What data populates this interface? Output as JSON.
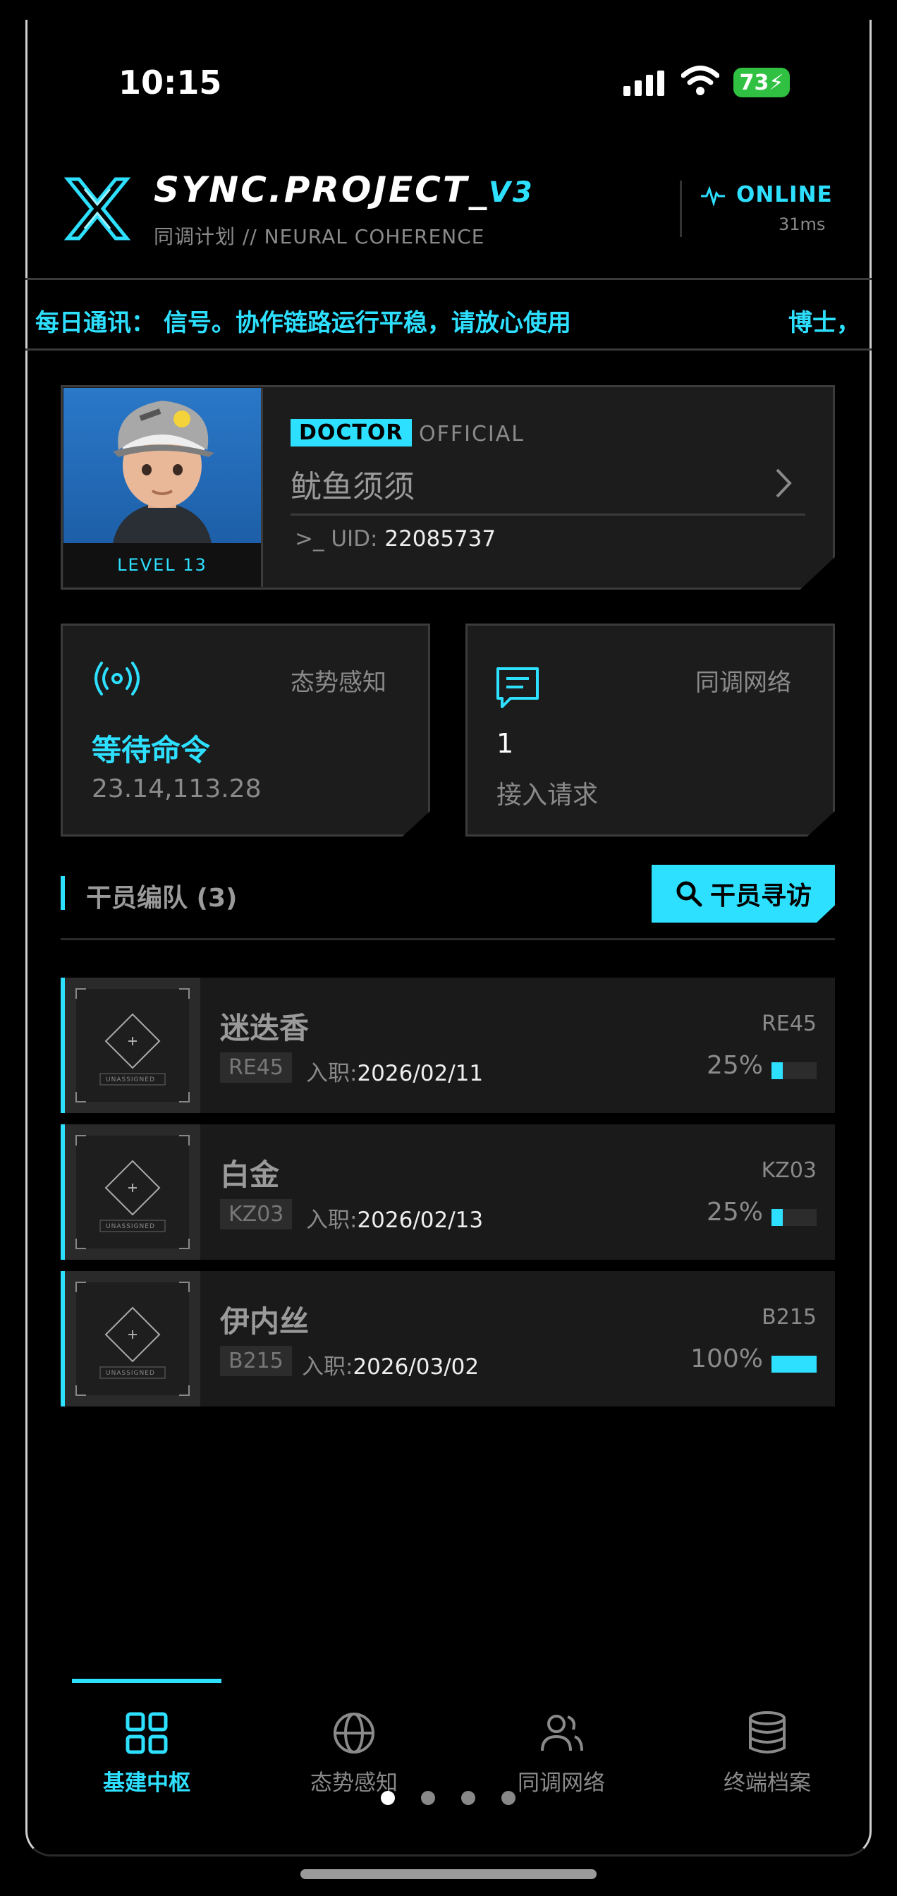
{
  "status_bar": {
    "time": "10:15",
    "battery": "73"
  },
  "header": {
    "brand": "SYNC.PROJECT_",
    "version": "V3",
    "subtitle": "同调计划 // NEURAL COHERENCE",
    "status": "ONLINE",
    "latency": "31ms"
  },
  "ticker": {
    "text": "每日通讯：  信号。协作链路运行平稳，请放心使用",
    "tail": "博士，"
  },
  "profile": {
    "badge": "DOCTOR",
    "badge_tag": "OFFICIAL",
    "name": "鱿鱼须须",
    "uid_label": ">_ UID:",
    "uid": "22085737",
    "level": "LEVEL 13"
  },
  "cards": [
    {
      "title": "态势感知",
      "icon": "radar-icon",
      "value": "等待命令",
      "detail": "23.14,113.28"
    },
    {
      "title": "同调网络",
      "icon": "chat-icon",
      "value": "1",
      "detail": "接入请求"
    }
  ],
  "section": {
    "title": "干员编队 (3)",
    "search_label": "干员寻访"
  },
  "operators": [
    {
      "name": "迷迭香",
      "code": "RE45",
      "join_label": "入职:",
      "date": "2026/02/11",
      "progress": "25%",
      "progress_value": 0.25,
      "thumb": "UNASSIGNED"
    },
    {
      "name": "白金",
      "code": "KZ03",
      "join_label": "入职:",
      "date": "2026/02/13",
      "progress": "25%",
      "progress_value": 0.25,
      "thumb": "UNASSIGNED"
    },
    {
      "name": "伊内丝",
      "code": "B215",
      "join_label": "入职:",
      "date": "2026/03/02",
      "progress": "100%",
      "progress_value": 1.0,
      "thumb": "UNASSIGNED"
    }
  ],
  "nav": [
    {
      "label": "基建中枢",
      "icon": "dashboard-icon",
      "active": true
    },
    {
      "label": "态势感知",
      "icon": "globe-icon",
      "active": false
    },
    {
      "label": "同调网络",
      "icon": "users-icon",
      "active": false
    },
    {
      "label": "终端档案",
      "icon": "database-icon",
      "active": false
    }
  ],
  "colors": {
    "accent": "#2ee0ff",
    "background": "#000000",
    "card": "#1c1c1c"
  }
}
